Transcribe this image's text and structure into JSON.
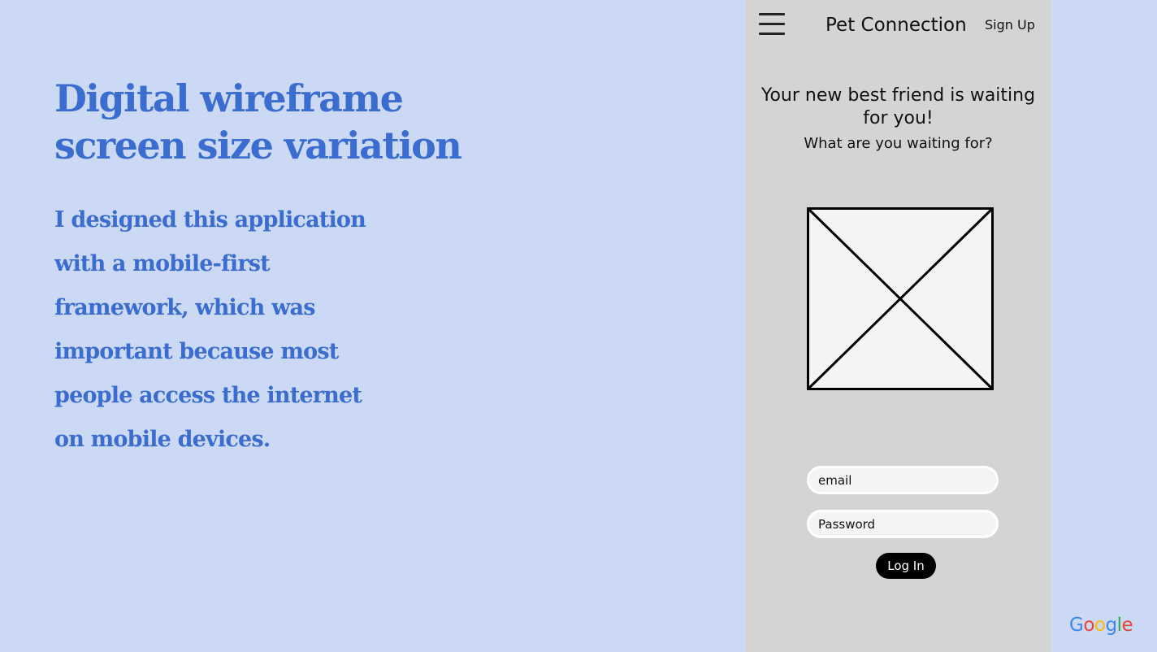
{
  "slide": {
    "title_line1": "Digital wireframe",
    "title_line2": "screen size variation",
    "body": "I designed this application with a mobile-first framework, which was important because most people access the internet on mobile devices."
  },
  "wireframe": {
    "menu_icon": "hamburger-menu-icon",
    "app_title": "Pet Connection",
    "sign_up_label": "Sign Up",
    "headline": "Your new best friend is waiting for you!",
    "subheadline": "What are you waiting for?",
    "image_icon": "image-placeholder-icon",
    "email_placeholder": "email",
    "password_placeholder": "Password",
    "login_label": "Log In"
  },
  "logo": {
    "text": "Google",
    "colors": [
      "#4285f4",
      "#ea4335",
      "#fbbc05",
      "#4285f4",
      "#34a853",
      "#ea4335"
    ]
  },
  "colors": {
    "page_background": "#cbd9f4",
    "heading_text": "#3b6ccf",
    "wireframe_background": "#d4d4d4",
    "field_background": "#f4f4f4",
    "button_background": "#000000"
  }
}
